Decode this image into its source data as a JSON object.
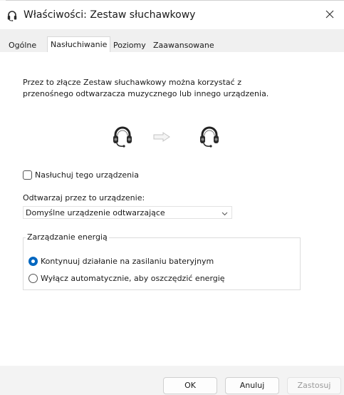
{
  "window": {
    "title": "Właściwości: Zestaw słuchawkowy",
    "title_icon": "headset-icon",
    "close_icon": "close-icon"
  },
  "tabs": [
    {
      "label": "Ogólne",
      "active": false
    },
    {
      "label": "Nasłuchiwanie",
      "active": true
    },
    {
      "label": "Poziomy",
      "active": false
    },
    {
      "label": "Zaawansowane",
      "active": false
    }
  ],
  "listen": {
    "description": "Przez to złącze Zestaw słuchawkowy można korzystać z przenośnego odtwarzacza muzycznego lub innego urządzenia.",
    "device_icons": [
      "headset-icon",
      "arrow-right-icon",
      "headset-icon"
    ],
    "listen_checkbox_label": "Nasłuchuj tego urządzenia",
    "listen_checked": false,
    "playback_label": "Odtwarzaj przez to urządzenie:",
    "playback_value": "Domyślne urządzenie odtwarzające"
  },
  "power": {
    "group_title": "Zarządzanie energią",
    "options": [
      {
        "label": "Kontynuuj działanie na zasilaniu bateryjnym",
        "selected": true
      },
      {
        "label": "Wyłącz automatycznie, aby oszczędzić energię",
        "selected": false
      }
    ]
  },
  "buttons": {
    "ok": "OK",
    "cancel": "Anuluj",
    "apply": "Zastosuj"
  },
  "colors": {
    "accent": "#0067c0",
    "window_bg": "#f3f3f3",
    "panel_bg": "#ffffff"
  }
}
